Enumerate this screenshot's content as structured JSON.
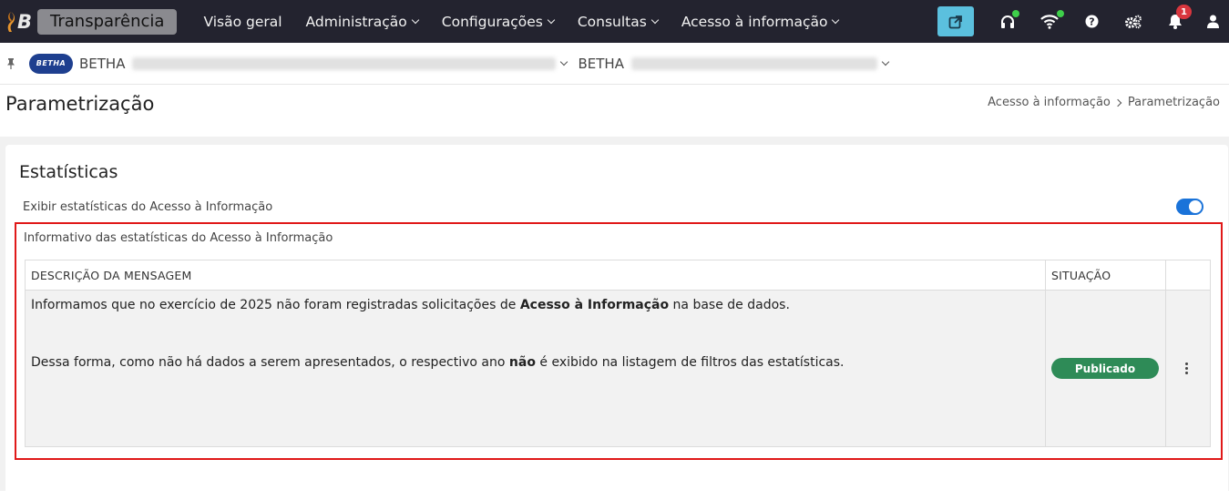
{
  "navbar": {
    "brand_name": "Transparência",
    "menu": [
      {
        "label": "Visão geral",
        "has_dropdown": false
      },
      {
        "label": "Administração",
        "has_dropdown": true
      },
      {
        "label": "Configurações",
        "has_dropdown": true
      },
      {
        "label": "Consultas",
        "has_dropdown": true
      },
      {
        "label": "Acesso à informação",
        "has_dropdown": true
      }
    ],
    "notification_count": "1",
    "icons": [
      "external-link-icon",
      "headset-icon",
      "wifi-icon",
      "help-icon",
      "settings-icon",
      "bell-icon",
      "user-icon"
    ],
    "colors": {
      "background": "#23232f",
      "external_button": "#5bc0de",
      "status_dot": "#3ecf4a",
      "badge": "#d9363e"
    }
  },
  "context": {
    "logo_text": "BETHA",
    "entity_prefix": "BETHA",
    "system_prefix": "BETHA"
  },
  "page": {
    "title": "Parametrização",
    "breadcrumb": [
      "Acesso à informação",
      "Parametrização"
    ]
  },
  "section": {
    "title": "Estatísticas",
    "setting_label": "Exibir estatísticas do Acesso à Informação",
    "setting_enabled": true,
    "info_title": "Informativo das estatísticas do Acesso à Informação",
    "table": {
      "headers": [
        "DESCRIÇÃO DA MENSAGEM",
        "SITUAÇÃO",
        ""
      ],
      "rows": [
        {
          "p1_before": "Informamos que no exercício de 2025 não foram registradas solicitações de ",
          "p1_bold": "Acesso à Informação",
          "p1_after": " na base de dados.",
          "p2_before": "Dessa forma, como não há dados a serem apresentados, o respectivo ano ",
          "p2_bold": "não",
          "p2_after": " é exibido na listagem de filtros das estatísticas.",
          "status": "Publicado"
        }
      ]
    },
    "colors": {
      "toggle": "#1a73d9",
      "status_badge": "#2e8b57",
      "highlight_border": "#e01919"
    }
  }
}
